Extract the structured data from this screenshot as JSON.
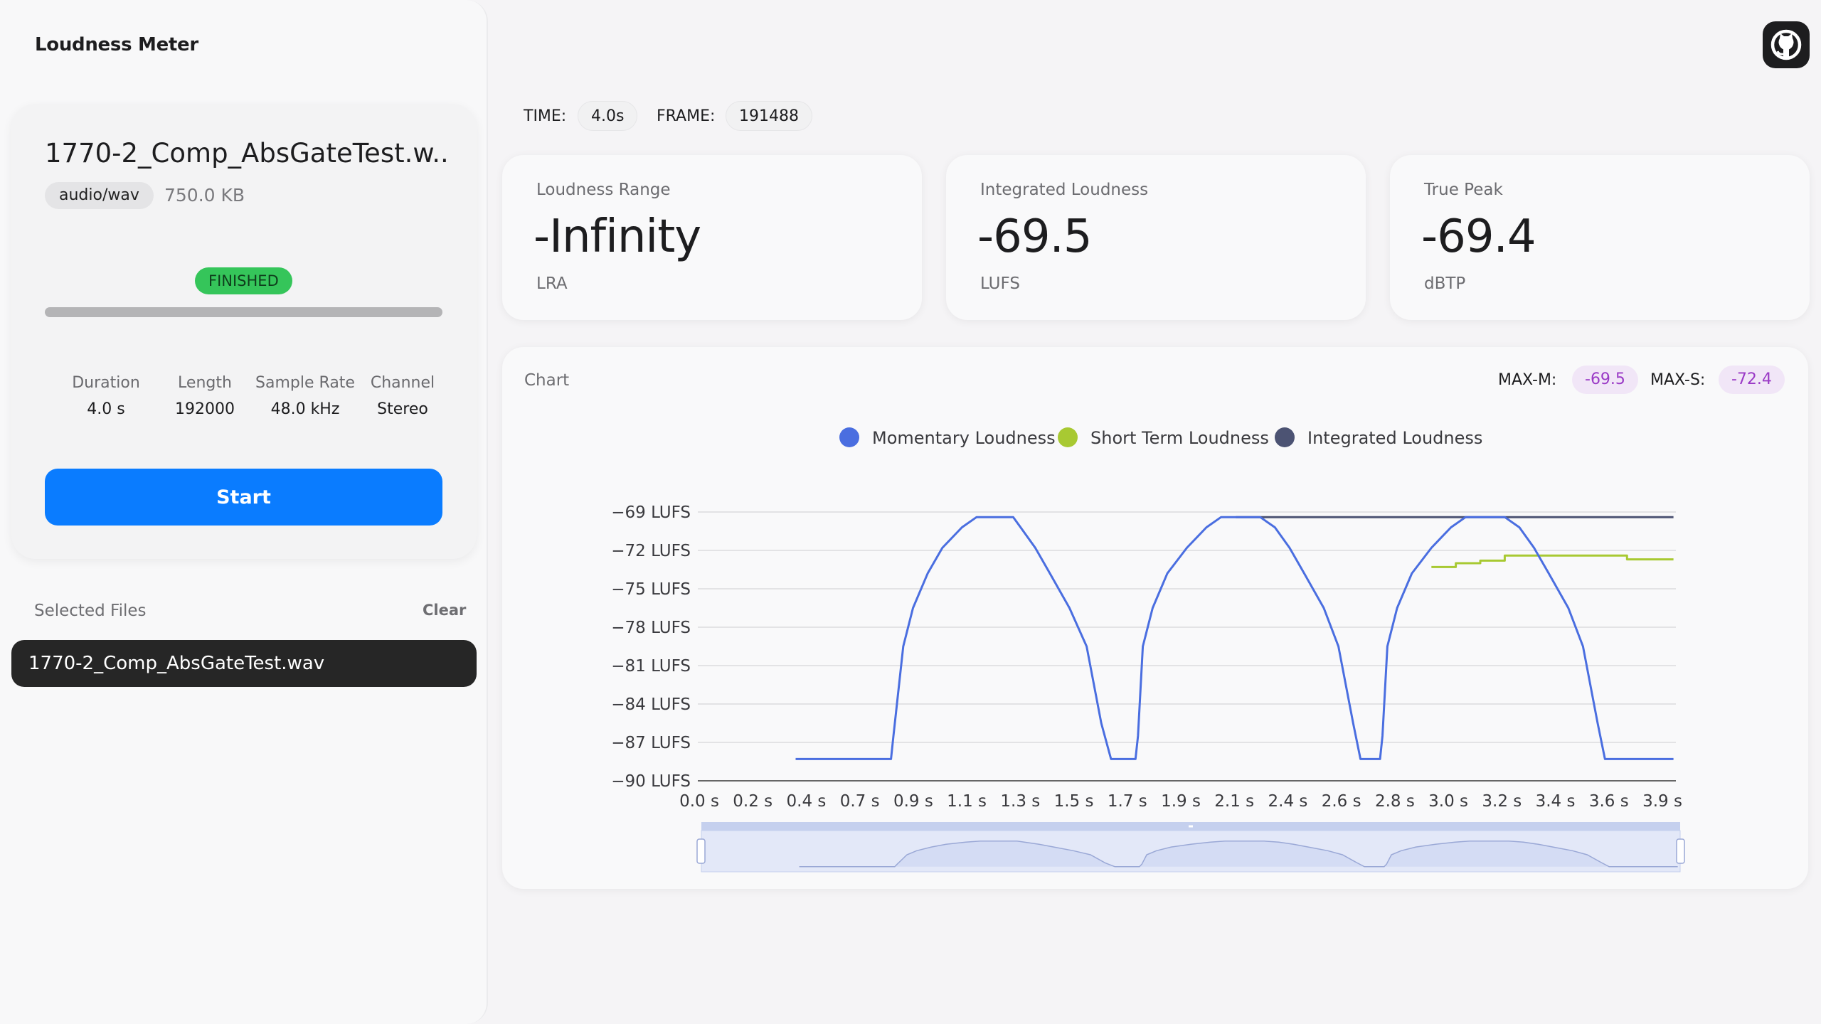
{
  "app": {
    "title": "Loudness Meter"
  },
  "file": {
    "name": "1770-2_Comp_AbsGateTest.w...",
    "mime": "audio/wav",
    "size": "750.0 KB",
    "status": "FINISHED",
    "progress": 1.0,
    "meta": [
      {
        "label": "Duration",
        "value": "4.0 s"
      },
      {
        "label": "Length",
        "value": "192000"
      },
      {
        "label": "Sample Rate",
        "value": "48.0 kHz"
      },
      {
        "label": "Channel",
        "value": "Stereo"
      }
    ],
    "start_label": "Start"
  },
  "selected": {
    "label": "Selected Files",
    "clear_label": "Clear",
    "items": [
      "1770-2_Comp_AbsGateTest.wav"
    ]
  },
  "header": {
    "time_label": "TIME:",
    "time_value": "4.0s",
    "frame_label": "FRAME:",
    "frame_value": "191488",
    "github_icon": "github-icon"
  },
  "stats": [
    {
      "title": "Loudness Range",
      "value": "-Infinity",
      "unit": "LRA"
    },
    {
      "title": "Integrated Loudness",
      "value": "-69.5",
      "unit": "LUFS"
    },
    {
      "title": "True Peak",
      "value": "-69.4",
      "unit": "dBTP"
    }
  ],
  "chart": {
    "title": "Chart",
    "max_m_label": "MAX-M:",
    "max_m_value": "-69.5",
    "max_s_label": "MAX-S:",
    "max_s_value": "-72.4"
  },
  "colors": {
    "accent": "#0a7cff",
    "finished": "#35c55a",
    "momentary": "#4a6ee0",
    "short_term": "#a8c932",
    "integrated": "#4c5373"
  },
  "chart_data": {
    "type": "line",
    "legend": [
      "Momentary Loudness",
      "Short Term Loudness",
      "Integrated Loudness"
    ],
    "legend_position": "top-center",
    "ylim": [
      -90,
      -69
    ],
    "y_ticks": [
      -69,
      -72,
      -75,
      -78,
      -81,
      -84,
      -87,
      -90
    ],
    "y_tick_labels": [
      "−69 LUFS",
      "−72 LUFS",
      "−75 LUFS",
      "−78 LUFS",
      "−81 LUFS",
      "−84 LUFS",
      "−87 LUFS",
      "−90 LUFS"
    ],
    "x_tick_labels": [
      "0.0 s",
      "0.2 s",
      "0.4 s",
      "0.7 s",
      "0.9 s",
      "1.1 s",
      "1.3 s",
      "1.5 s",
      "1.7 s",
      "1.9 s",
      "2.1 s",
      "2.4 s",
      "2.6 s",
      "2.8 s",
      "3.0 s",
      "3.2 s",
      "3.4 s",
      "3.6 s",
      "3.9 s"
    ],
    "xlim": [
      0,
      4.0
    ],
    "grid": true,
    "series": [
      {
        "name": "Momentary Loudness",
        "x": [
          0.4,
          0.79,
          0.8,
          0.84,
          0.88,
          0.94,
          1.0,
          1.08,
          1.14,
          1.22,
          1.29,
          1.32,
          1.38,
          1.44,
          1.52,
          1.59,
          1.65,
          1.69,
          1.71,
          1.79,
          1.8,
          1.82,
          1.86,
          1.92,
          2.0,
          2.08,
          2.14,
          2.22,
          2.3,
          2.36,
          2.42,
          2.48,
          2.56,
          2.62,
          2.68,
          2.71,
          2.79,
          2.8,
          2.82,
          2.86,
          2.92,
          3.0,
          3.08,
          3.14,
          3.22,
          3.3,
          3.36,
          3.42,
          3.48,
          3.56,
          3.62,
          3.68,
          3.71,
          3.99
        ],
        "y": [
          -88.3,
          -88.3,
          -86.5,
          -79.5,
          -76.5,
          -73.8,
          -71.8,
          -70.2,
          -69.4,
          -69.4,
          -69.4,
          -70.2,
          -71.8,
          -73.8,
          -76.5,
          -79.5,
          -85.5,
          -88.3,
          -88.3,
          -88.3,
          -86.5,
          -79.5,
          -76.5,
          -73.8,
          -71.8,
          -70.2,
          -69.4,
          -69.4,
          -69.4,
          -70.2,
          -71.8,
          -73.8,
          -76.5,
          -79.5,
          -85.5,
          -88.3,
          -88.3,
          -86.5,
          -79.5,
          -76.5,
          -73.8,
          -71.8,
          -70.2,
          -69.4,
          -69.4,
          -69.4,
          -70.2,
          -71.8,
          -73.8,
          -76.5,
          -79.5,
          -85.5,
          -88.3,
          -88.3
        ]
      },
      {
        "name": "Short Term Loudness",
        "x": [
          3.0,
          3.1,
          3.1,
          3.2,
          3.2,
          3.3,
          3.3,
          3.8,
          3.8,
          3.99
        ],
        "y": [
          -73.3,
          -73.3,
          -73.0,
          -73.0,
          -72.8,
          -72.8,
          -72.4,
          -72.4,
          -72.7,
          -72.7
        ]
      },
      {
        "name": "Integrated Loudness",
        "x": [
          2.2,
          3.99
        ],
        "y": [
          -69.4,
          -69.4
        ]
      }
    ]
  }
}
